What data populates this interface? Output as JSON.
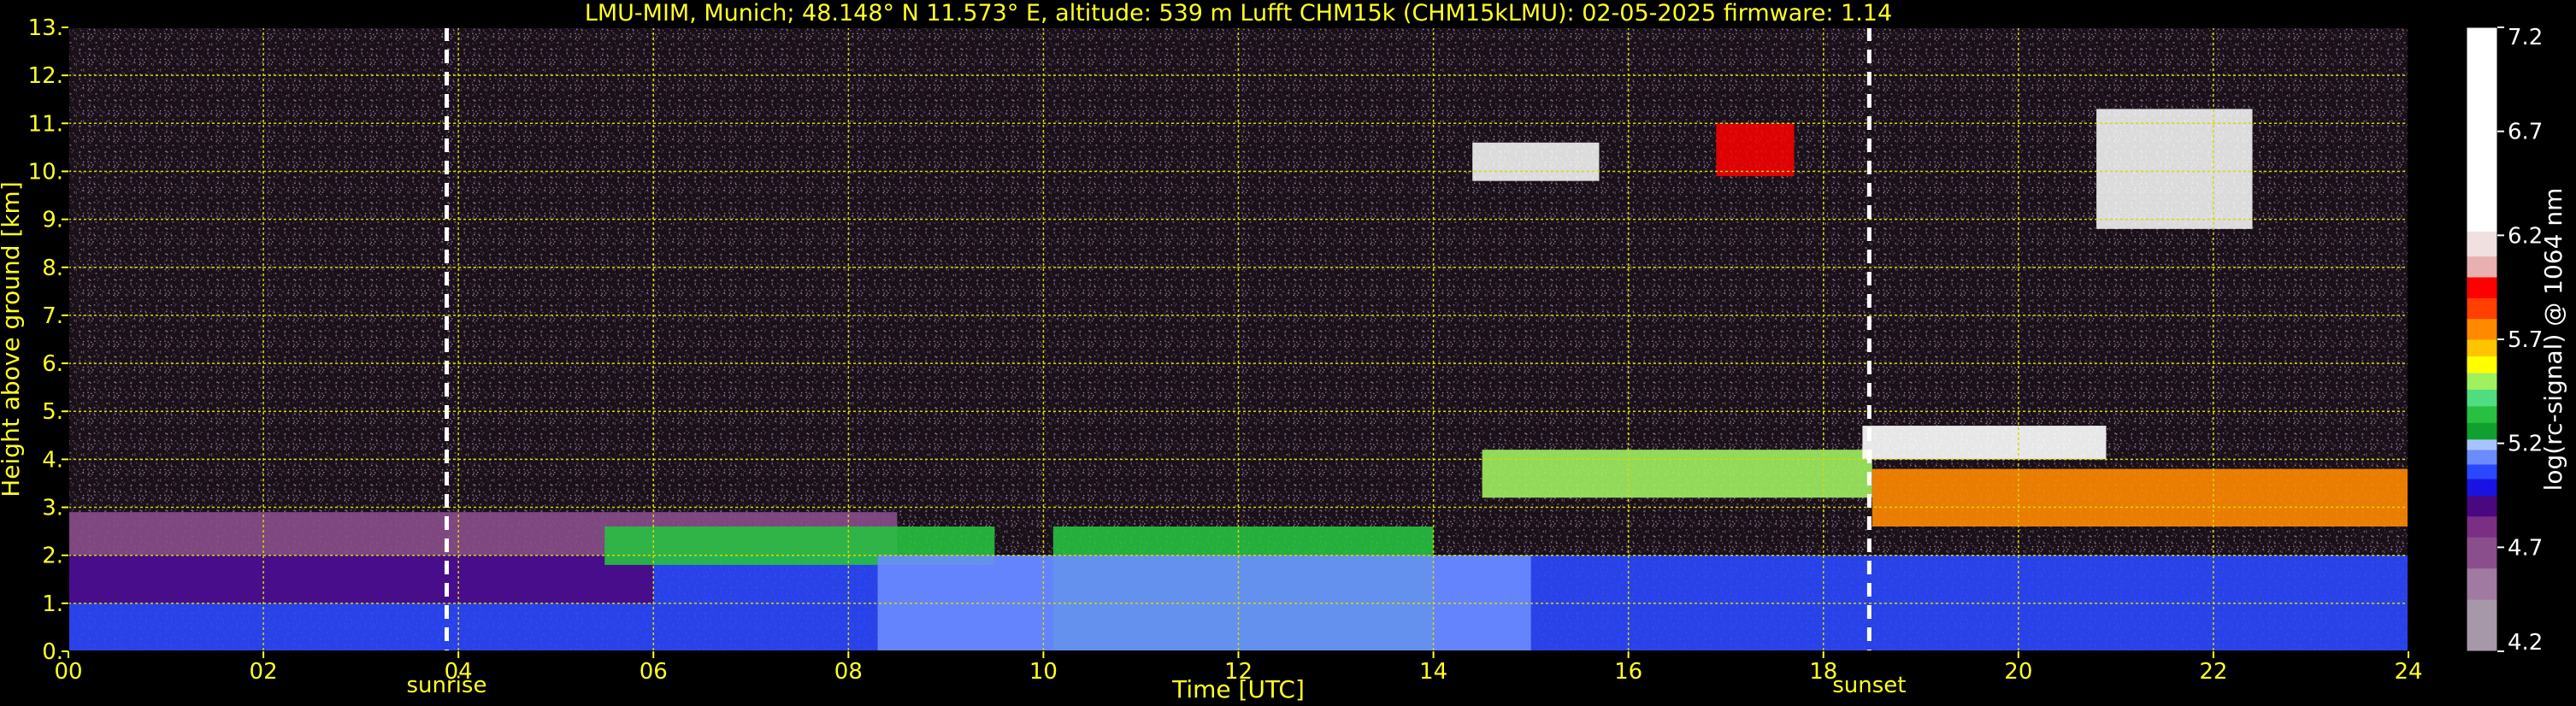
{
  "chart_data": {
    "type": "heatmap",
    "title": "LMU-MIM, Munich; 48.148° N 11.573° E, altitude: 539 m    Lufft CHM15k (CHM15kLMU): 02-05-2025    firmware: 1.14",
    "xlabel": "Time [UTC]",
    "ylabel": "Height above ground [km]",
    "xlim": [
      0,
      24
    ],
    "ylim": [
      0,
      13
    ],
    "x_ticks": [
      {
        "value": 0,
        "label": "00"
      },
      {
        "value": 2,
        "label": "02"
      },
      {
        "value": 4,
        "label": "04"
      },
      {
        "value": 6,
        "label": "06"
      },
      {
        "value": 8,
        "label": "08"
      },
      {
        "value": 10,
        "label": "10"
      },
      {
        "value": 12,
        "label": "12"
      },
      {
        "value": 14,
        "label": "14"
      },
      {
        "value": 16,
        "label": "16"
      },
      {
        "value": 18,
        "label": "18"
      },
      {
        "value": 20,
        "label": "20"
      },
      {
        "value": 22,
        "label": "22"
      },
      {
        "value": 24,
        "label": "24"
      }
    ],
    "y_ticks": [
      {
        "value": 0,
        "label": "0."
      },
      {
        "value": 1,
        "label": "1."
      },
      {
        "value": 2,
        "label": "2."
      },
      {
        "value": 3,
        "label": "3."
      },
      {
        "value": 4,
        "label": "4."
      },
      {
        "value": 5,
        "label": "5."
      },
      {
        "value": 6,
        "label": "6."
      },
      {
        "value": 7,
        "label": "7."
      },
      {
        "value": 8,
        "label": "8."
      },
      {
        "value": 9,
        "label": "9."
      },
      {
        "value": 10,
        "label": "10."
      },
      {
        "value": 11,
        "label": "11."
      },
      {
        "value": 12,
        "label": "12."
      },
      {
        "value": 13,
        "label": "13."
      }
    ],
    "grid": true,
    "grid_color": "#d8d800",
    "text_color": "#ffff22",
    "markers": [
      {
        "label": "sunrise",
        "time": 3.88
      },
      {
        "label": "sunset",
        "time": 18.47
      }
    ],
    "colorbar": {
      "label": "log(rc-signal) @ 1064 nm",
      "range": [
        4.2,
        7.2
      ],
      "ticks": [
        4.2,
        4.7,
        5.2,
        5.7,
        6.2,
        6.7,
        7.2
      ],
      "tick_labels": [
        "4.2",
        "4.7",
        "5.2",
        "5.7",
        "6.2",
        "6.7",
        "7.2"
      ],
      "colors": [
        {
          "from": 4.2,
          "to": 4.45,
          "color": "#a698a8"
        },
        {
          "from": 4.45,
          "to": 4.6,
          "color": "#a07aa0"
        },
        {
          "from": 4.6,
          "to": 4.75,
          "color": "#8a4e8c"
        },
        {
          "from": 4.75,
          "to": 4.85,
          "color": "#7a2e84"
        },
        {
          "from": 4.85,
          "to": 4.95,
          "color": "#4a0880"
        },
        {
          "from": 4.95,
          "to": 5.03,
          "color": "#1a12e0"
        },
        {
          "from": 5.03,
          "to": 5.1,
          "color": "#2a48ff"
        },
        {
          "from": 5.1,
          "to": 5.17,
          "color": "#6a8cff"
        },
        {
          "from": 5.17,
          "to": 5.22,
          "color": "#a6c4ff"
        },
        {
          "from": 5.22,
          "to": 5.3,
          "color": "#10a030"
        },
        {
          "from": 5.3,
          "to": 5.38,
          "color": "#28c040"
        },
        {
          "from": 5.38,
          "to": 5.46,
          "color": "#50dc80"
        },
        {
          "from": 5.46,
          "to": 5.54,
          "color": "#a0f060"
        },
        {
          "from": 5.54,
          "to": 5.62,
          "color": "#ffff00"
        },
        {
          "from": 5.62,
          "to": 5.7,
          "color": "#ffc400"
        },
        {
          "from": 5.7,
          "to": 5.8,
          "color": "#ff8a00"
        },
        {
          "from": 5.8,
          "to": 5.9,
          "color": "#ff4000"
        },
        {
          "from": 5.9,
          "to": 6.0,
          "color": "#ff0000"
        },
        {
          "from": 6.0,
          "to": 6.1,
          "color": "#e8b0b0"
        },
        {
          "from": 6.1,
          "to": 6.22,
          "color": "#f0e0e0"
        },
        {
          "from": 6.22,
          "to": 7.2,
          "color": "#ffffff"
        }
      ]
    },
    "features": [
      {
        "kind": "boundary-layer",
        "t_start": 0,
        "t_end": 24,
        "h_bottom": 0,
        "h_top": 2.0,
        "value": 5.05
      },
      {
        "kind": "residual-layer",
        "t_start": 0,
        "t_end": 6,
        "h_bottom": 1.0,
        "h_top": 2.0,
        "value": 4.85
      },
      {
        "kind": "aerosol-layer",
        "t_start": 0,
        "t_end": 8.5,
        "h_bottom": 2.0,
        "h_top": 2.9,
        "value": 4.65
      },
      {
        "kind": "aerosol-layer",
        "t_start": 5.5,
        "t_end": 9.5,
        "h_bottom": 1.8,
        "h_top": 2.6,
        "value": 5.3
      },
      {
        "kind": "convective-layer",
        "t_start": 10.1,
        "t_end": 14.0,
        "h_bottom": 0,
        "h_top": 2.6,
        "value": 5.32
      },
      {
        "kind": "mixed-layer",
        "t_start": 8.3,
        "t_end": 15.0,
        "h_bottom": 0,
        "h_top": 2.0,
        "value": 5.15
      },
      {
        "kind": "aerosol-layer",
        "t_start": 14.5,
        "t_end": 18.5,
        "h_bottom": 3.2,
        "h_top": 4.2,
        "value": 5.5
      },
      {
        "kind": "aerosol-layer",
        "t_start": 18.5,
        "t_end": 24,
        "h_bottom": 2.6,
        "h_top": 3.8,
        "value": 5.7
      },
      {
        "kind": "cloud",
        "t_start": 18.4,
        "t_end": 20.9,
        "h_bottom": 4.0,
        "h_top": 4.7,
        "value": 7.0
      },
      {
        "kind": "cirrus",
        "t_start": 14.4,
        "t_end": 15.7,
        "h_bottom": 9.8,
        "h_top": 10.6,
        "value": 6.5
      },
      {
        "kind": "cirrus",
        "t_start": 16.9,
        "t_end": 17.7,
        "h_bottom": 9.9,
        "h_top": 11.0,
        "value": 5.9
      },
      {
        "kind": "cirrus",
        "t_start": 20.8,
        "t_end": 22.4,
        "h_bottom": 8.8,
        "h_top": 11.3,
        "value": 6.8
      }
    ]
  }
}
